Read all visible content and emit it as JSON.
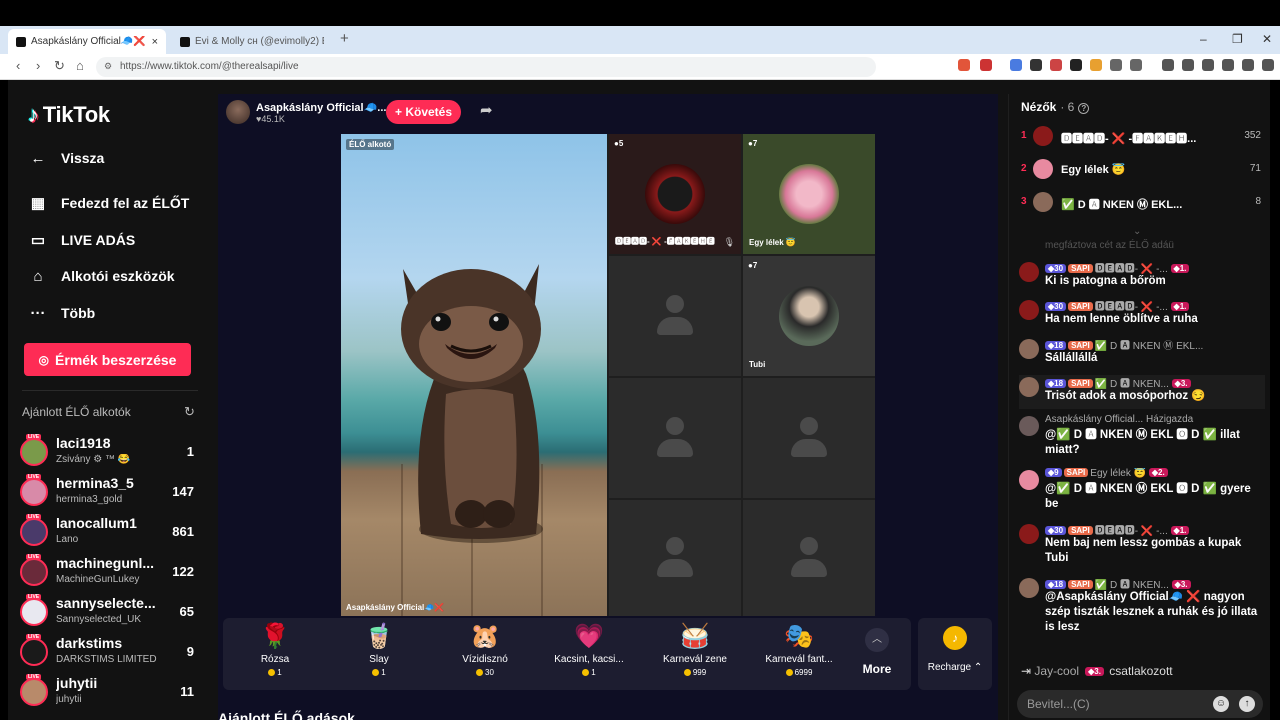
{
  "browser": {
    "tabs": [
      {
        "title": "Asapkáslány Official🧢❌ (@"
      },
      {
        "title": "Évi & Molly сн (@evimolly2) ÉLŐ adá"
      }
    ],
    "new_tab": "+",
    "url": "https://www.tiktok.com/@therealsapi/live"
  },
  "sidebar": {
    "logo": "TikTok",
    "nav": [
      {
        "label": "Vissza",
        "icon": "back-arrow-icon"
      },
      {
        "label": "Fedezd fel az ÉLŐT",
        "icon": "calendar-icon"
      },
      {
        "label": "LIVE ADÁS",
        "icon": "video-camera-icon"
      },
      {
        "label": "Alkotói eszközök",
        "icon": "creator-tools-icon"
      },
      {
        "label": "Több",
        "icon": "more-dots-icon"
      }
    ],
    "coins_button": "Érmék beszerzése",
    "recommended_title": "Ajánlott ÉLŐ alkotók",
    "creators": [
      {
        "name": "laci1918",
        "sub": "Zsivány ⚙ ™ 😂",
        "count": "1",
        "color": "#7a9a4a"
      },
      {
        "name": "hermina3_5",
        "sub": "hermina3_gold",
        "count": "147",
        "color": "#d88aa8"
      },
      {
        "name": "lanocallum1",
        "sub": "Lano",
        "count": "861",
        "color": "#4a3a6a"
      },
      {
        "name": "machinegunl...",
        "sub": "MachineGunLukey",
        "count": "122",
        "color": "#6a2a3a"
      },
      {
        "name": "sannyselecte...",
        "sub": "Sannyselected_UK",
        "count": "65",
        "color": "#e8e8f0"
      },
      {
        "name": "darkstims",
        "sub": "DARKSTIMS LIMITED",
        "count": "9",
        "color": "#1a1a1a"
      },
      {
        "name": "juhytii",
        "sub": "juhytii",
        "count": "11",
        "color": "#b88a6a"
      }
    ]
  },
  "stream": {
    "host_name": "Asapkáslány Official🧢...",
    "host_likes": "♥45.1K",
    "follow_label": "+ Követés",
    "creator_tag": "ÉLŐ alkotó",
    "host_caption": "Asapkáslány Official🧢❌",
    "guests": [
      {
        "badge": "●5",
        "caption": "🅳🅴🅰🅳- ❌ -🅵🅰🅺🅴🅷🅴",
        "kind": "avatar",
        "color": "#8a1a1a"
      },
      {
        "badge": "●7",
        "caption": "Egy lélek 😇",
        "kind": "avatar",
        "color": "#e88aa0"
      },
      {
        "badge": "",
        "caption": "",
        "kind": "empty"
      },
      {
        "badge": "●7",
        "caption": "Tubi",
        "kind": "avatar",
        "color": "#5a6a5a"
      },
      {
        "badge": "",
        "caption": "",
        "kind": "empty"
      },
      {
        "badge": "",
        "caption": "",
        "kind": "empty"
      },
      {
        "badge": "",
        "caption": "",
        "kind": "empty"
      },
      {
        "badge": "",
        "caption": "",
        "kind": "empty"
      }
    ]
  },
  "gifts": [
    {
      "name": "Rózsa",
      "price": "1",
      "icon": "🌹"
    },
    {
      "name": "Slay",
      "price": "1",
      "icon": "🧋"
    },
    {
      "name": "Vízidisznó",
      "price": "30",
      "icon": "🐹"
    },
    {
      "name": "Kacsint, kacsi...",
      "price": "1",
      "icon": "💗"
    },
    {
      "name": "Karnevál zene",
      "price": "999",
      "icon": "🥁"
    },
    {
      "name": "Karnevál fant...",
      "price": "6999",
      "icon": "🎭"
    }
  ],
  "gift_more": "More",
  "recharge": {
    "label": "Recharge ⌃",
    "icon": "♪"
  },
  "bottom_heading": "Ajánlott ÉLŐ adások",
  "viewers": {
    "title": "Nézők",
    "count": "· 6",
    "ranks": [
      {
        "n": "1",
        "name": "🅳🅴🅰🅳- ❌ -🅵🅰🅺🅴🅷...",
        "score": "352",
        "color": "#8a1a1a"
      },
      {
        "n": "2",
        "name": "Egy lélek 😇",
        "score": "71",
        "color": "#e88aa0"
      },
      {
        "n": "3",
        "name": "✅ D 🅰 NKEN Ⓜ EKL...",
        "score": "8",
        "color": "#8a6a5a"
      }
    ]
  },
  "chat": {
    "faded": "megfáztova cét az ÉLŐ adáü",
    "messages": [
      {
        "lvl": "30",
        "user": "🅳🅴🅰🅳- ❌ -...",
        "fan": "1",
        "text": "Ki is patogna a bőröm",
        "color": "#8a1a1a"
      },
      {
        "lvl": "30",
        "user": "🅳🅴🅰🅳- ❌ -...",
        "fan": "1",
        "text": "Ha nem lenne öblítve a ruha",
        "color": "#8a1a1a"
      },
      {
        "lvl": "18",
        "user": "✅ D 🅰 NKEN Ⓜ EKL...",
        "fan": "",
        "text": "Sállállállá",
        "color": "#8a6a5a"
      },
      {
        "lvl": "18",
        "user": "✅ D 🅰 NKEN...",
        "fan": "3",
        "text": "Trisót adok a mosóporhoz 😏",
        "color": "#8a6a5a"
      },
      {
        "lvl": "",
        "user": "Asapkáslány Official... Házigazda",
        "fan": "",
        "text": "@✅ D 🅰 NKEN Ⓜ EKL 🅾 D ✅ illat miatt?",
        "color": "#6a5a5a"
      },
      {
        "lvl": "9",
        "user": "Egy lélek 😇",
        "fan": "2",
        "text": "@✅ D 🅰 NKEN Ⓜ EKL 🅾 D ✅ gyere be",
        "color": "#e88aa0"
      },
      {
        "lvl": "30",
        "user": "🅳🅴🅰🅳- ❌ -...",
        "fan": "1",
        "text": "Nem baj nem lessz gombás a kupak Tubi",
        "color": "#8a1a1a"
      },
      {
        "lvl": "18",
        "user": "✅ D 🅰 NKEN...",
        "fan": "3",
        "text": "@Asapkáslány Official🧢 ❌ nagyon szép tiszták lesznek a ruhák és jó illata is lesz",
        "color": "#8a6a5a"
      }
    ],
    "join": {
      "user": "Jay-cool",
      "fan": "3",
      "text": "csatlakozott"
    },
    "input_placeholder": "Bevitel...(C)"
  }
}
